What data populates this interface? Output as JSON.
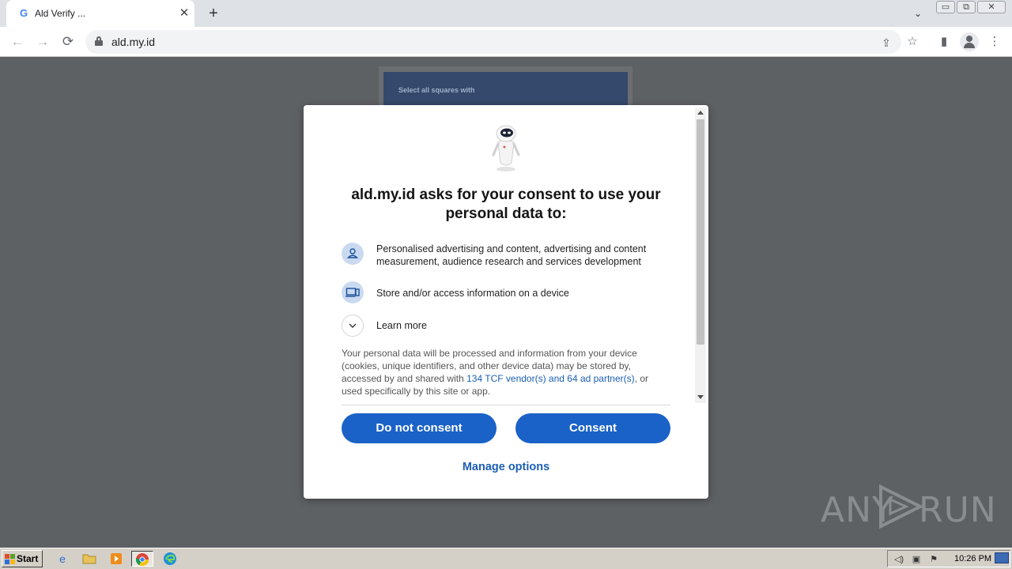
{
  "browser": {
    "tab": {
      "favicon": "G",
      "title": "Ald Verify ...",
      "close": "✕"
    },
    "new_tab": "+",
    "tab_search": "⌄",
    "window": {
      "minimize": "▭",
      "restore": "⧉",
      "close": "✕"
    },
    "toolbar": {
      "back": "←",
      "forward": "→",
      "reload": "⟳",
      "share": "⇪",
      "bookmark": "☆",
      "sidepanel": "▮",
      "menu": "⋮"
    },
    "url": "ald.my.id"
  },
  "page_behind": {
    "captcha_prompt": "Select all squares with"
  },
  "consent": {
    "heading": "ald.my.id asks for your consent to use your personal data to:",
    "purposes": [
      {
        "icon": "person-icon",
        "text": "Personalised advertising and content, advertising and content measurement, audience research and services development"
      },
      {
        "icon": "devices-icon",
        "text": "Store and/or access information on a device"
      }
    ],
    "learn_more": "Learn more",
    "body_pre": "Your personal data will be processed and information from your device (cookies, unique identifiers, and other device data) may be stored by, accessed by and shared with ",
    "body_link": "134 TCF vendor(s) and 64 ad partner(s)",
    "body_post": ", or used specifically by this site or app.",
    "do_not_consent": "Do not consent",
    "consent": "Consent",
    "manage_options": "Manage options"
  },
  "watermark": {
    "left": "ANY",
    "right": "RUN"
  },
  "taskbar": {
    "start": "Start",
    "clock": "10:26 PM"
  },
  "colors": {
    "accent": "#1a62c7",
    "link": "#1a5fb4",
    "overlay": "#5e6164"
  }
}
